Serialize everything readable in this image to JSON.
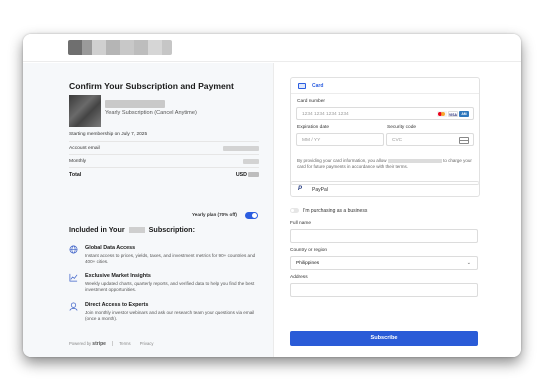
{
  "header": {
    "logo_alt": ""
  },
  "summary": {
    "title": "Confirm Your Subscription and Payment",
    "product_sub": "Yearly Subscription (Cancel Anytime)",
    "starting": "Starting membership on July 7, 2025",
    "rows": {
      "email_label": "Account email",
      "monthly_label": "Monthly",
      "total_label": "Total",
      "total_currency": "USD"
    },
    "yearly_plan": "Yearly plan (70% off)",
    "yearly_plan_on": true,
    "included_prefix": "Included in Your",
    "included_suffix": "Subscription:",
    "features": [
      {
        "icon": "globe-icon",
        "title": "Global Data Access",
        "desc": "Instant access to prices, yields, taxes, and investment metrics for 90+ countries and 400+ cities."
      },
      {
        "icon": "chart-icon",
        "title": "Exclusive Market Insights",
        "desc": "Weekly updated charts, quarterly reports, and verified data to help you find the best investment opportunities."
      },
      {
        "icon": "experts-icon",
        "title": "Direct Access to Experts",
        "desc": "Join monthly investor webinars and ask our research team your questions via email (once a month)."
      }
    ],
    "footer": {
      "powered_by": "Powered by",
      "brand": "stripe",
      "terms": "Terms",
      "privacy": "Privacy"
    }
  },
  "payment": {
    "card_tab": "Card",
    "card_number_label": "Card number",
    "card_number_placeholder": "1234 1234 1234 1234",
    "brands": [
      "mastercard",
      "visa",
      "amex"
    ],
    "expiration_label": "Expiration date",
    "expiration_placeholder": "MM / YY",
    "security_label": "Security code",
    "security_placeholder": "CVC",
    "consent_start": "By providing your card information, you allow",
    "consent_end": "to charge your card for future payments in accordance with their terms.",
    "paypal_label": "PayPal",
    "business_label": "I'm purchasing as a business",
    "fullname_label": "Full name",
    "country_label": "Country or region",
    "country_value": "Philippines",
    "address_label": "Address",
    "subscribe_label": "Subscribe",
    "accent": "#2a5bd7"
  }
}
